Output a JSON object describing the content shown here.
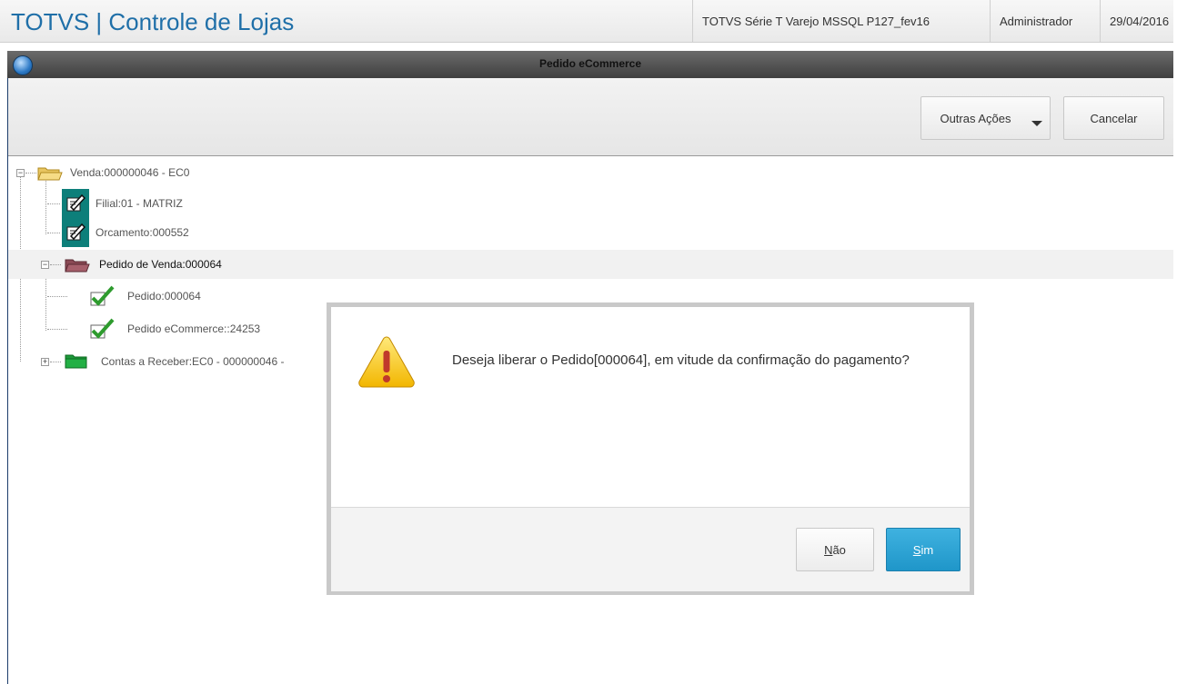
{
  "app": {
    "title": "TOTVS | Controle de Lojas",
    "environment": "TOTVS Série T Varejo MSSQL P127_fev16",
    "user": "Administrador",
    "date": "29/04/2016"
  },
  "window": {
    "title": "Pedido eCommerce"
  },
  "toolbar": {
    "more_actions_label": "Outras Ações",
    "cancel_label": "Cancelar"
  },
  "tree": {
    "venda": "Venda:000000046 - EC0",
    "filial": "Filial:01 - MATRIZ",
    "orcamento": "Orcamento:000552",
    "pedido_venda": "Pedido de Venda:000064",
    "pedido": "Pedido:000064",
    "pedido_ecommerce": "Pedido eCommerce::24253",
    "contas_receber": "Contas a Receber:EC0 - 000000046 -"
  },
  "dialog": {
    "message": "Deseja liberar o Pedido[000064], em vitude da confirmação do pagamento?",
    "no_first": "N",
    "no_rest": "ão",
    "yes_first": "S",
    "yes_rest": "im"
  },
  "colors": {
    "brand": "#1f6fa8",
    "accent": "#1f96c9",
    "selected_row": "#f1f1f1"
  }
}
